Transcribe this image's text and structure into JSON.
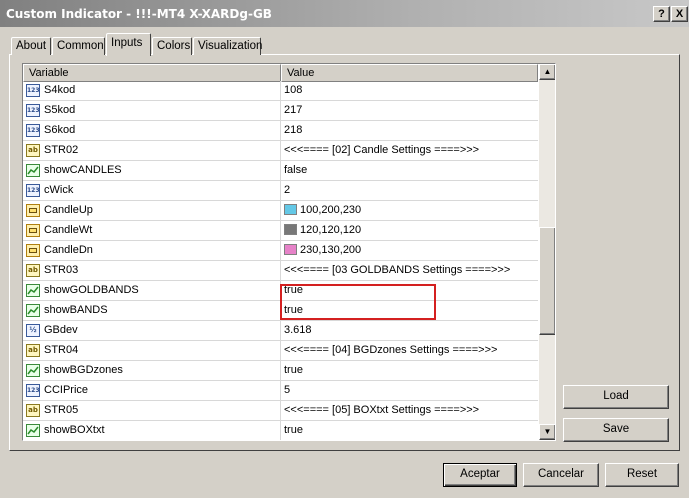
{
  "window": {
    "title": "Custom Indicator - !!!-MT4 X-XARDg-GB",
    "help_label": "?",
    "close_label": "X"
  },
  "tabs": [
    {
      "label": "About"
    },
    {
      "label": "Common"
    },
    {
      "label": "Inputs",
      "active": true
    },
    {
      "label": "Colors"
    },
    {
      "label": "Visualization"
    }
  ],
  "grid": {
    "columns": {
      "variable": "Variable",
      "value": "Value"
    },
    "rows": [
      {
        "type": "int",
        "name": "S4kod",
        "value": "108"
      },
      {
        "type": "int",
        "name": "S5kod",
        "value": "217"
      },
      {
        "type": "int",
        "name": "S6kod",
        "value": "218"
      },
      {
        "type": "string",
        "name": "STR02",
        "value": "<<<==== [02] Candle Settings ====>>>"
      },
      {
        "type": "bool",
        "name": "showCANDLES",
        "value": "false"
      },
      {
        "type": "int",
        "name": "cWick",
        "value": "2"
      },
      {
        "type": "color",
        "name": "CandleUp",
        "value": "100,200,230",
        "swatch": "#64c8e6"
      },
      {
        "type": "color",
        "name": "CandleWt",
        "value": "120,120,120",
        "swatch": "#787878"
      },
      {
        "type": "color",
        "name": "CandleDn",
        "value": "230,130,200",
        "swatch": "#e682c8"
      },
      {
        "type": "string",
        "name": "STR03",
        "value": "<<<==== [03 GOLDBANDS Settings ====>>>"
      },
      {
        "type": "bool",
        "name": "showGOLDBANDS",
        "value": "true"
      },
      {
        "type": "bool",
        "name": "showBANDS",
        "value": "true"
      },
      {
        "type": "double",
        "name": "GBdev",
        "value": "3.618"
      },
      {
        "type": "string",
        "name": "STR04",
        "value": "<<<==== [04] BGDzones Settings ====>>>"
      },
      {
        "type": "bool",
        "name": "showBGDzones",
        "value": "true"
      },
      {
        "type": "int",
        "name": "CCIPrice",
        "value": "5"
      },
      {
        "type": "string",
        "name": "STR05",
        "value": "<<<==== [05] BOXtxt Settings ====>>>"
      },
      {
        "type": "bool",
        "name": "showBOXtxt",
        "value": "true"
      }
    ],
    "icon_labels": {
      "int": "123",
      "string": "ab",
      "double": "½"
    },
    "scroll_position": 0.45
  },
  "side_buttons": {
    "load": "Load",
    "save": "Save"
  },
  "footer": {
    "ok": "Aceptar",
    "cancel": "Cancelar",
    "reset": "Reset"
  }
}
